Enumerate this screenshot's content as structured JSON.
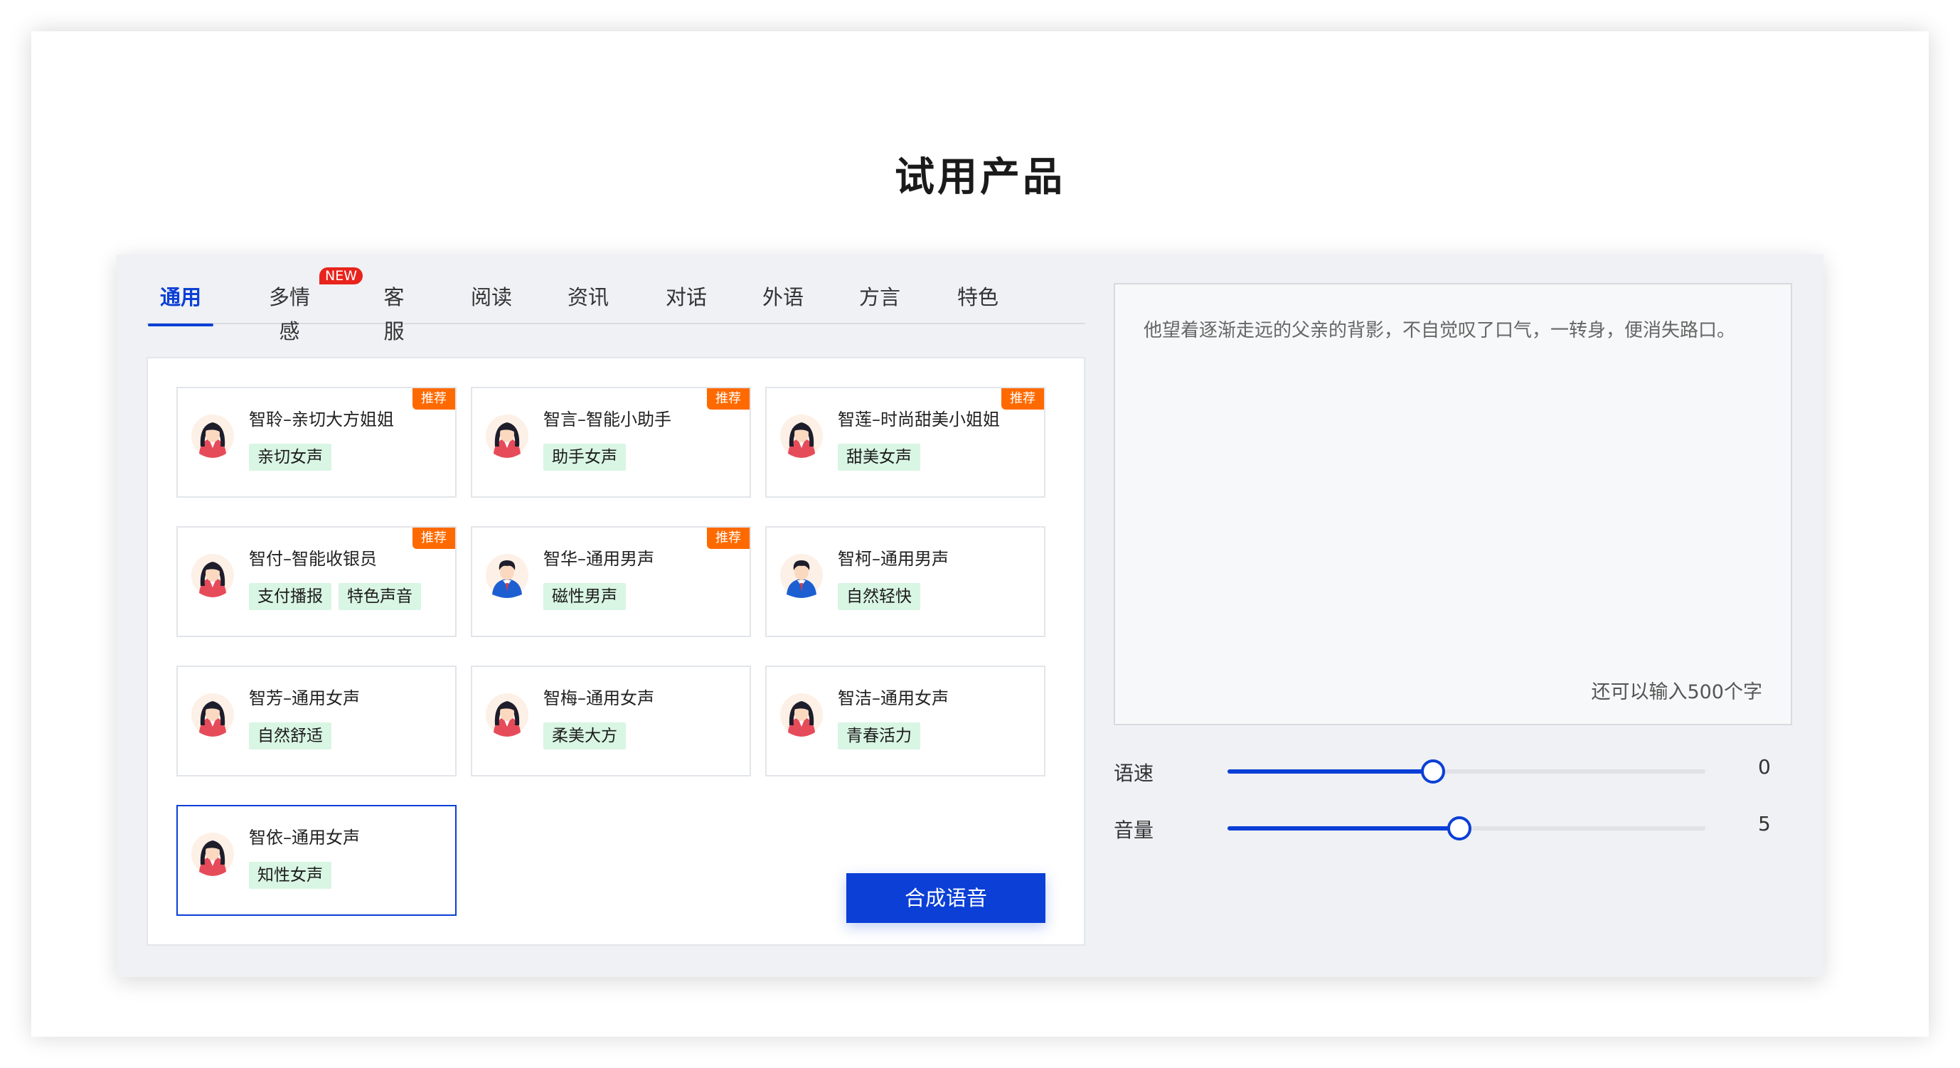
{
  "page": {
    "title": "试用产品"
  },
  "tabs": [
    {
      "label": "通用",
      "active": true
    },
    {
      "label": "多情感",
      "badge": "NEW"
    },
    {
      "label": "客服"
    },
    {
      "label": "阅读"
    },
    {
      "label": "资讯"
    },
    {
      "label": "对话"
    },
    {
      "label": "外语"
    },
    {
      "label": "方言"
    },
    {
      "label": "特色"
    }
  ],
  "voices": [
    {
      "name": "智聆–亲切大方姐姐",
      "gender": "female",
      "tags": [
        "亲切女声"
      ],
      "badge": "推荐"
    },
    {
      "name": "智言–智能小助手",
      "gender": "female",
      "tags": [
        "助手女声"
      ],
      "badge": "推荐"
    },
    {
      "name": "智莲–时尚甜美小姐姐",
      "gender": "female",
      "tags": [
        "甜美女声"
      ],
      "badge": "推荐"
    },
    {
      "name": "智付–智能收银员",
      "gender": "female",
      "tags": [
        "支付播报",
        "特色声音"
      ],
      "badge": "推荐"
    },
    {
      "name": "智华–通用男声",
      "gender": "male",
      "tags": [
        "磁性男声"
      ],
      "badge": "推荐"
    },
    {
      "name": "智柯–通用男声",
      "gender": "male",
      "tags": [
        "自然轻快"
      ]
    },
    {
      "name": "智芳–通用女声",
      "gender": "female",
      "tags": [
        "自然舒适"
      ]
    },
    {
      "name": "智梅–通用女声",
      "gender": "female",
      "tags": [
        "柔美大方"
      ]
    },
    {
      "name": "智洁–通用女声",
      "gender": "female",
      "tags": [
        "青春活力"
      ]
    },
    {
      "name": "智依–通用女声",
      "gender": "female",
      "tags": [
        "知性女声"
      ],
      "selected": true
    }
  ],
  "text_input": {
    "value": "他望着逐渐走远的父亲的背影，不自觉叹了口气，一转身，便消失路口。",
    "counter": "还可以输入500个字"
  },
  "sliders": [
    {
      "label": "语速",
      "value": "0",
      "fill_fraction": 0.43
    },
    {
      "label": "音量",
      "value": "5",
      "fill_fraction": 0.485
    }
  ],
  "action": {
    "synthesize_label": "合成语音"
  },
  "colors": {
    "accent": "#0b3fd6",
    "badge_orange": "#ff6a00",
    "badge_red": "#e8241c",
    "tag_green_bg": "#d9f5e3"
  }
}
